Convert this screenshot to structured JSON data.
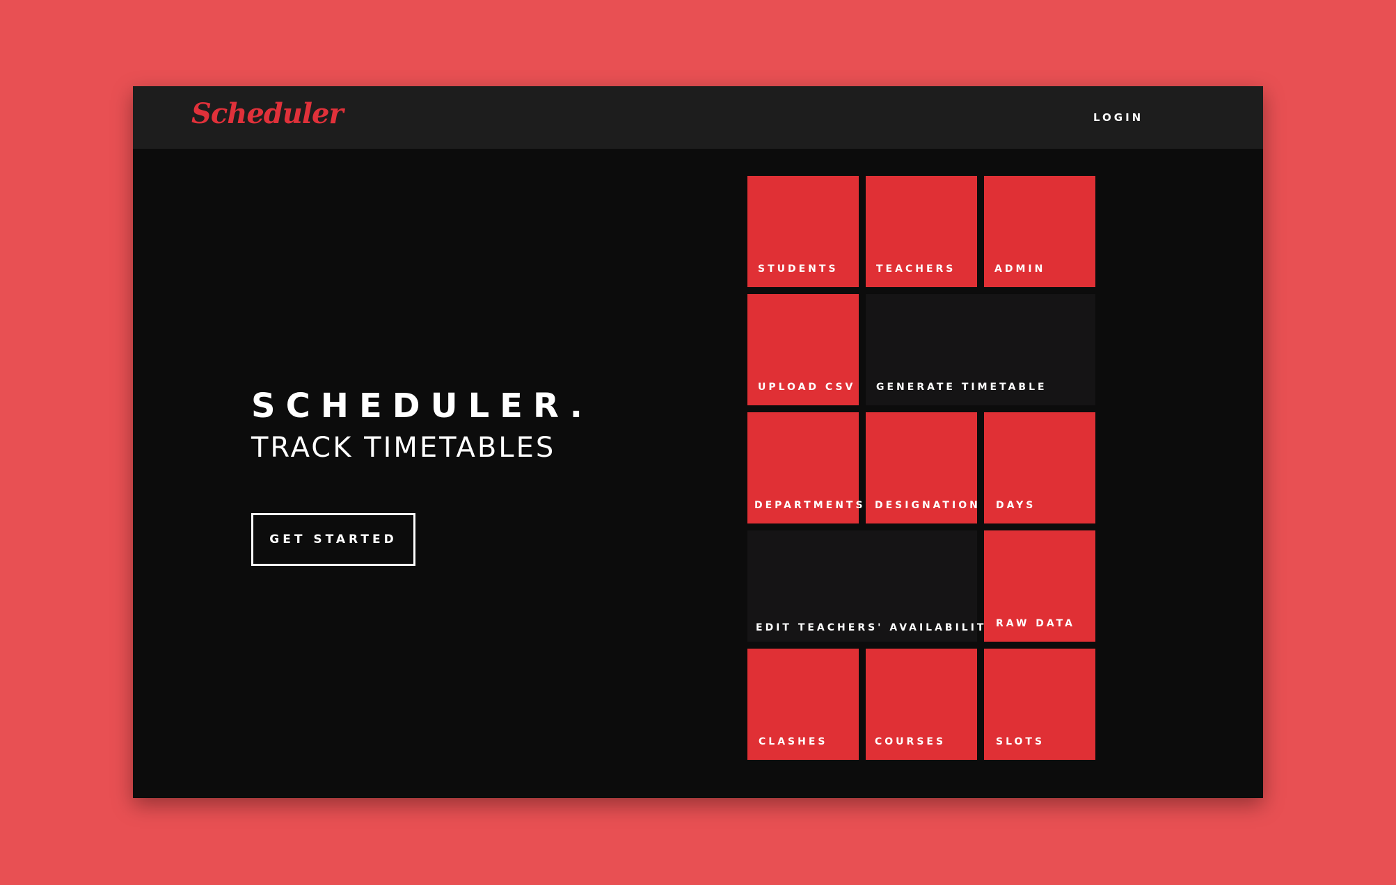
{
  "nav": {
    "logo": "Scheduler",
    "login_label": "LOGIN"
  },
  "hero": {
    "title": "SCHEDULER.",
    "subtitle": "TRACK TIMETABLES",
    "cta_label": "GET STARTED"
  },
  "tiles": [
    {
      "label": "STUDENTS",
      "style": "red"
    },
    {
      "label": "TEACHERS",
      "style": "red"
    },
    {
      "label": "ADMIN",
      "style": "red"
    },
    {
      "label": "UPLOAD CSV",
      "style": "red"
    },
    {
      "label": "GENERATE TIMETABLE",
      "style": "dark"
    },
    {
      "label": "DEPARTMENTS",
      "style": "red"
    },
    {
      "label": "DESIGNATION",
      "style": "red"
    },
    {
      "label": "DAYS",
      "style": "red"
    },
    {
      "label": "EDIT TEACHERS' AVAILABILITY",
      "style": "dark"
    },
    {
      "label": "RAW DATA",
      "style": "red"
    },
    {
      "label": "CLASHES",
      "style": "red"
    },
    {
      "label": "COURSES",
      "style": "red"
    },
    {
      "label": "SLOTS",
      "style": "red"
    }
  ],
  "colors": {
    "page_background": "#e85053",
    "accent": "#e03035",
    "app_background": "#0c0c0c",
    "navbar_background": "#1d1d1d",
    "dark_tile": "#151415"
  }
}
